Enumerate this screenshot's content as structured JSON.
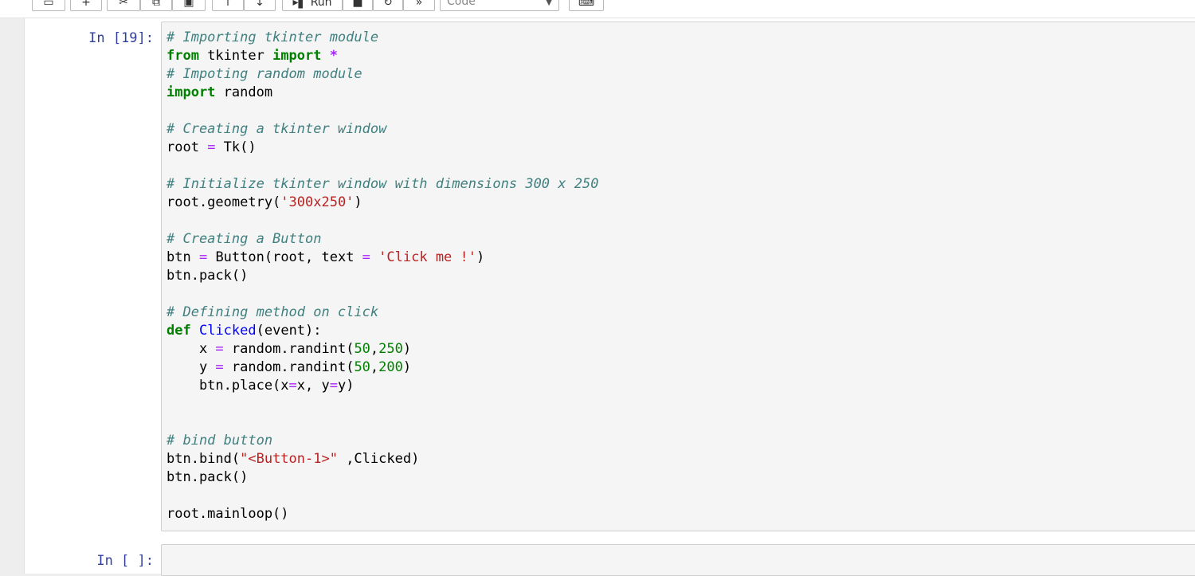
{
  "toolbar": {
    "run_label": "Run",
    "cell_type": "Code"
  },
  "cells": [
    {
      "prompt": "In [19]:",
      "code": [
        "# Importing tkinter module",
        "from tkinter import *",
        "# Impoting random module",
        "import random",
        "",
        "# Creating a tkinter window",
        "root = Tk()",
        "",
        "# Initialize tkinter window with dimensions 300 x 250",
        "root.geometry('300x250')",
        "",
        "# Creating a Button",
        "btn = Button(root, text = 'Click me !')",
        "btn.pack()",
        "",
        "# Defining method on click",
        "def Clicked(event):",
        "    x = random.randint(50,250)",
        "    y = random.randint(50,200)",
        "    btn.place(x=x, y=y)",
        "",
        "",
        "# bind button",
        "btn.bind(\"<Button-1>\" ,Clicked)",
        "btn.pack()",
        "",
        "root.mainloop()"
      ]
    },
    {
      "prompt": "In [ ]:",
      "code": []
    }
  ]
}
